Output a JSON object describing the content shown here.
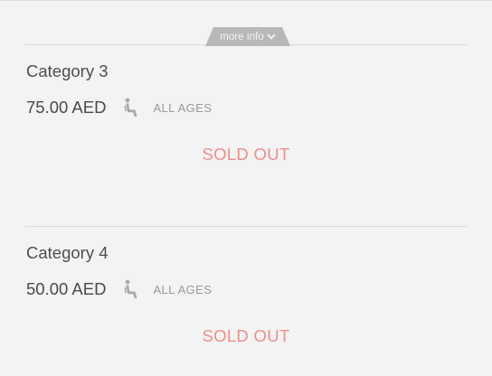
{
  "more_info": {
    "label": "more info",
    "icon": "chevron-down-icon",
    "tab_color": "#b8b8b8"
  },
  "categories": [
    {
      "title": "Category 3",
      "price": "75.00 AED",
      "seat_icon": "seat-icon",
      "ages": "ALL AGES",
      "status": "SOLD OUT"
    },
    {
      "title": "Category 4",
      "price": "50.00 AED",
      "seat_icon": "seat-icon",
      "ages": "ALL AGES",
      "status": "SOLD OUT"
    }
  ],
  "colors": {
    "background": "#f3f3f3",
    "sold_out": "#ef8d8d",
    "text": "#4a4a4a",
    "muted": "#9a9a9a"
  }
}
